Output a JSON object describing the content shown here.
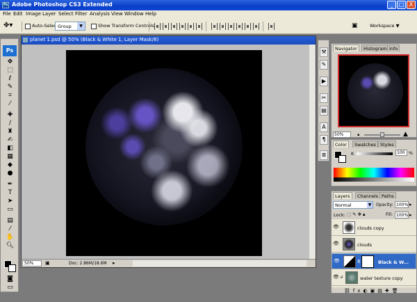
{
  "app": {
    "title": "Adobe Photoshop CS3 Extended",
    "logo": "Ps"
  },
  "window_buttons": {
    "minimize": "_",
    "maximize": "□",
    "close": "X"
  },
  "menu": [
    "File",
    "Edit",
    "Image",
    "Layer",
    "Select",
    "Filter",
    "Analysis",
    "View",
    "Window",
    "Help"
  ],
  "options": {
    "auto_select_label": "Auto-Select:",
    "auto_select_value": "Group",
    "show_transform_label": "Show Transform Controls",
    "workspace_label": "Workspace ▼"
  },
  "document": {
    "title": "planet 1.psd @ 50% (Black & White 1, Layer Mask/8)",
    "zoom": "50%",
    "doc_size": "Doc: 2.86M/18.6M"
  },
  "navigator": {
    "tabs": [
      "Navigator",
      "Histogram",
      "Info"
    ],
    "zoom": "50%",
    "zoom_level": 0.5
  },
  "color_panel": {
    "tabs": [
      "Color",
      "Swatches",
      "Styles"
    ],
    "channel_label": "K",
    "value": "100",
    "unit": "%"
  },
  "layers_panel": {
    "tabs": [
      "Layers",
      "Channels",
      "Paths"
    ],
    "blend_mode": "Normal",
    "opacity_label": "Opacity:",
    "opacity_value": "100%",
    "lock_label": "Lock:",
    "fill_label": "Fill:",
    "fill_value": "100%",
    "layers": [
      {
        "name": "clouds copy",
        "selected": false
      },
      {
        "name": "clouds",
        "selected": false
      },
      {
        "name": "Black & W...",
        "selected": true
      },
      {
        "name": "water texture copy",
        "selected": false
      }
    ]
  },
  "colors": {
    "title_blue": "#0a3fc8",
    "selection_blue": "#3169c6",
    "nav_frame": "#d42b2b"
  }
}
